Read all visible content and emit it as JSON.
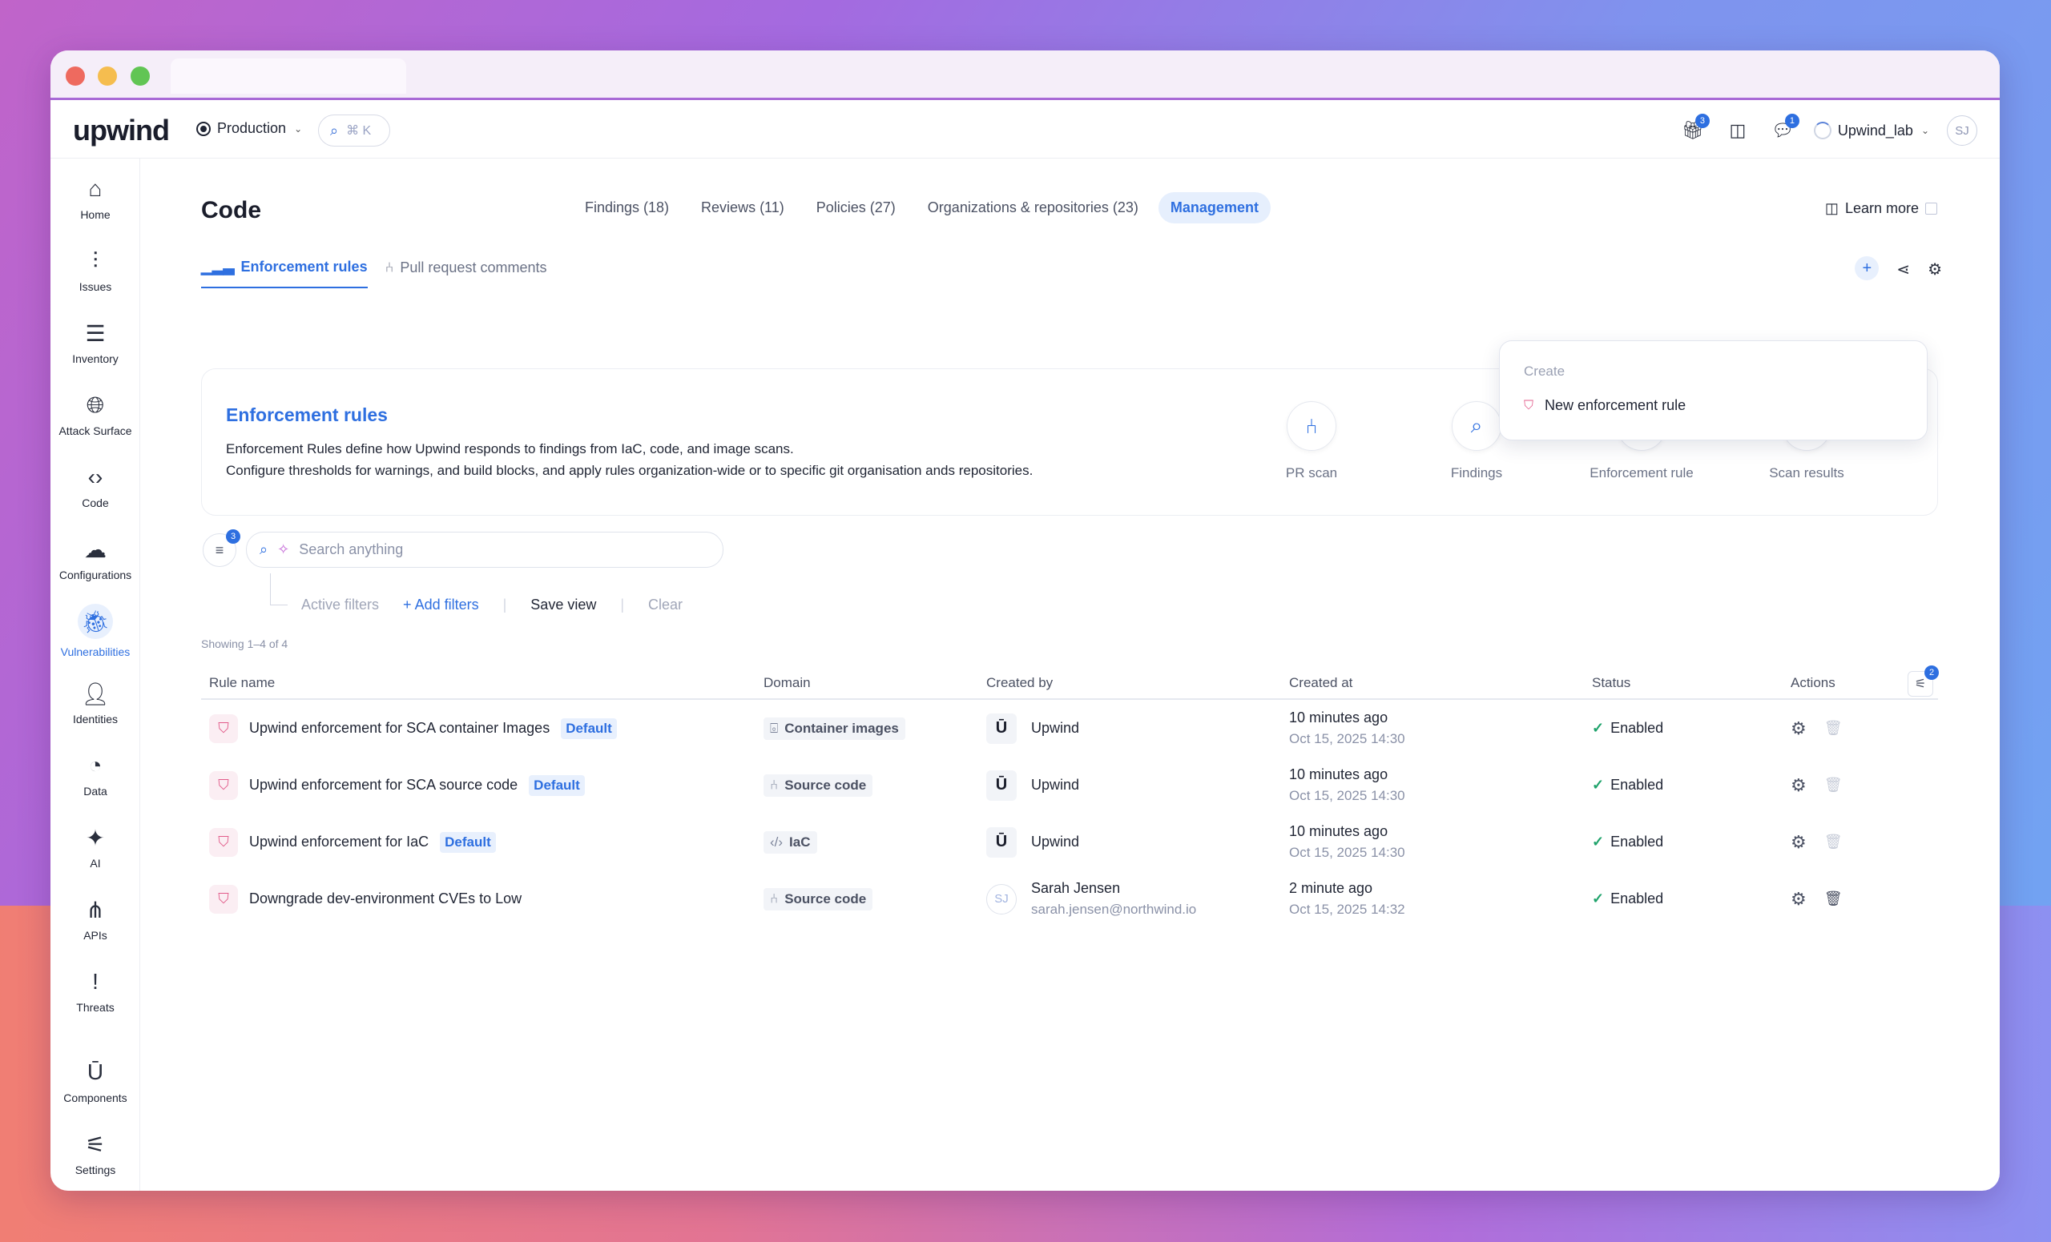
{
  "app": {
    "logo": "upwind",
    "environment": "Production",
    "search_shortcut": "⌘ K",
    "gift_badge": "3",
    "chat_badge": "1",
    "org_name": "Upwind_lab",
    "user_initials": "SJ"
  },
  "sidebar": {
    "items": [
      {
        "label": "Home",
        "icon": "home-icon"
      },
      {
        "label": "Issues",
        "icon": "pulse-icon"
      },
      {
        "label": "Inventory",
        "icon": "list-icon"
      },
      {
        "label": "Attack Surface",
        "icon": "globe-icon"
      },
      {
        "label": "Code",
        "icon": "code-icon"
      },
      {
        "label": "Configurations",
        "icon": "cloud-icon"
      },
      {
        "label": "Vulnerabilities",
        "icon": "bug-icon"
      },
      {
        "label": "Identities",
        "icon": "person-icon"
      },
      {
        "label": "Data",
        "icon": "pie-icon"
      },
      {
        "label": "AI",
        "icon": "sparkle-icon"
      },
      {
        "label": "APIs",
        "icon": "share-icon"
      },
      {
        "label": "Threats",
        "icon": "exclamation-icon"
      },
      {
        "label": "Components",
        "icon": "components-icon"
      },
      {
        "label": "Settings",
        "icon": "sliders-icon"
      }
    ]
  },
  "header": {
    "title": "Code",
    "tabs": [
      {
        "label": "Findings (18)"
      },
      {
        "label": "Reviews (11)"
      },
      {
        "label": "Policies (27)"
      },
      {
        "label": "Organizations & repositories (23)"
      },
      {
        "label": "Management"
      }
    ],
    "learn_more": "Learn more"
  },
  "subtabs": [
    {
      "label": "Enforcement rules"
    },
    {
      "label": "Pull request comments"
    }
  ],
  "info_card": {
    "title": "Enforcement rules",
    "line1": "Enforcement Rules define how Upwind responds to findings from IaC, code, and image scans.",
    "line2": "Configure thresholds for warnings, and build blocks, and apply rules organization-wide or to specific git organisation ands repositories.",
    "flow": [
      {
        "label": "PR scan"
      },
      {
        "label": "Findings"
      },
      {
        "label": "Enforcement rule"
      },
      {
        "label": "Scan results"
      }
    ]
  },
  "create_menu": {
    "header": "Create",
    "item": "New enforcement rule"
  },
  "filters": {
    "count_badge": "3",
    "search_placeholder": "Search anything",
    "active_filters": "Active filters",
    "add_filters": "Add filters",
    "save_view": "Save view",
    "clear": "Clear",
    "showing": "Showing 1–4 of 4"
  },
  "table": {
    "columns": [
      "Rule name",
      "Domain",
      "Created by",
      "Created at",
      "Status",
      "Actions"
    ],
    "column_badge": "2",
    "rows": [
      {
        "name": "Upwind enforcement for SCA container Images",
        "tag": "Default",
        "domain": "Container images",
        "created_by": "Upwind",
        "email": "",
        "rel_time": "10 minutes ago",
        "abs_time": "Oct 15, 2025 14:30",
        "status": "Enabled"
      },
      {
        "name": "Upwind enforcement for SCA source code",
        "tag": "Default",
        "domain": "Source code",
        "created_by": "Upwind",
        "email": "",
        "rel_time": "10 minutes ago",
        "abs_time": "Oct 15, 2025 14:30",
        "status": "Enabled"
      },
      {
        "name": "Upwind enforcement for IaC",
        "tag": "Default",
        "domain": "IaC",
        "created_by": "Upwind",
        "email": "",
        "rel_time": "10 minutes ago",
        "abs_time": "Oct 15, 2025 14:30",
        "status": "Enabled"
      },
      {
        "name": "Downgrade dev-environment CVEs to Low",
        "tag": "",
        "domain": "Source code",
        "created_by": "Sarah Jensen",
        "email": "sarah.jensen@northwind.io",
        "creator_initials": "SJ",
        "rel_time": "2 minute ago",
        "abs_time": "Oct 15, 2025 14:32",
        "status": "Enabled"
      }
    ]
  },
  "colors": {
    "accent": "#2e6fe0",
    "success": "#1fa36b",
    "rule_icon": "#e25b8a"
  }
}
